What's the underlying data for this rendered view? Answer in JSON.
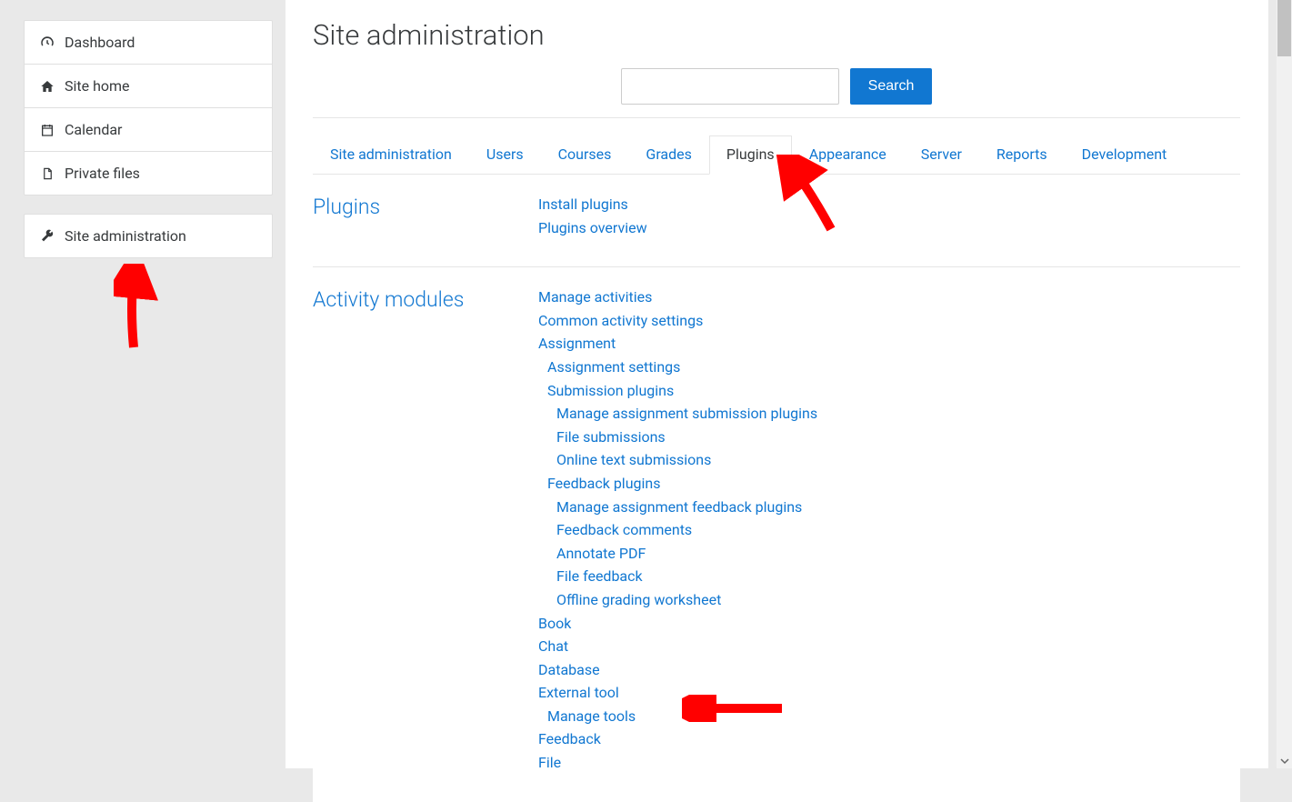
{
  "sidebar": {
    "groups": [
      {
        "items": [
          {
            "icon": "tachometer",
            "label": "Dashboard",
            "name": "nav-dashboard"
          },
          {
            "icon": "home",
            "label": "Site home",
            "name": "nav-site-home"
          },
          {
            "icon": "calendar",
            "label": "Calendar",
            "name": "nav-calendar"
          },
          {
            "icon": "file",
            "label": "Private files",
            "name": "nav-private-files"
          }
        ]
      },
      {
        "items": [
          {
            "icon": "wrench",
            "label": "Site administration",
            "name": "nav-site-administration"
          }
        ]
      }
    ]
  },
  "page_title": "Site administration",
  "search_button": "Search",
  "tabs": [
    {
      "label": "Site administration",
      "active": false
    },
    {
      "label": "Users",
      "active": false
    },
    {
      "label": "Courses",
      "active": false
    },
    {
      "label": "Grades",
      "active": false
    },
    {
      "label": "Plugins",
      "active": true
    },
    {
      "label": "Appearance",
      "active": false
    },
    {
      "label": "Server",
      "active": false
    },
    {
      "label": "Reports",
      "active": false
    },
    {
      "label": "Development",
      "active": false
    }
  ],
  "sections": [
    {
      "title": "Plugins",
      "links": [
        {
          "label": "Install plugins",
          "level": 0
        },
        {
          "label": "Plugins overview",
          "level": 0
        }
      ]
    },
    {
      "title": "Activity modules",
      "links": [
        {
          "label": "Manage activities",
          "level": 0
        },
        {
          "label": "Common activity settings",
          "level": 0
        },
        {
          "label": "Assignment",
          "level": 0
        },
        {
          "label": "Assignment settings",
          "level": 1
        },
        {
          "label": "Submission plugins",
          "level": 1
        },
        {
          "label": "Manage assignment submission plugins",
          "level": 2
        },
        {
          "label": "File submissions",
          "level": 2
        },
        {
          "label": "Online text submissions",
          "level": 2
        },
        {
          "label": "Feedback plugins",
          "level": 1
        },
        {
          "label": "Manage assignment feedback plugins",
          "level": 2
        },
        {
          "label": "Feedback comments",
          "level": 2
        },
        {
          "label": "Annotate PDF",
          "level": 2
        },
        {
          "label": "File feedback",
          "level": 2
        },
        {
          "label": "Offline grading worksheet",
          "level": 2
        },
        {
          "label": "Book",
          "level": 0
        },
        {
          "label": "Chat",
          "level": 0
        },
        {
          "label": "Database",
          "level": 0
        },
        {
          "label": "External tool",
          "level": 0
        },
        {
          "label": "Manage tools",
          "level": 1
        },
        {
          "label": "Feedback",
          "level": 0
        },
        {
          "label": "File",
          "level": 0
        }
      ]
    }
  ]
}
